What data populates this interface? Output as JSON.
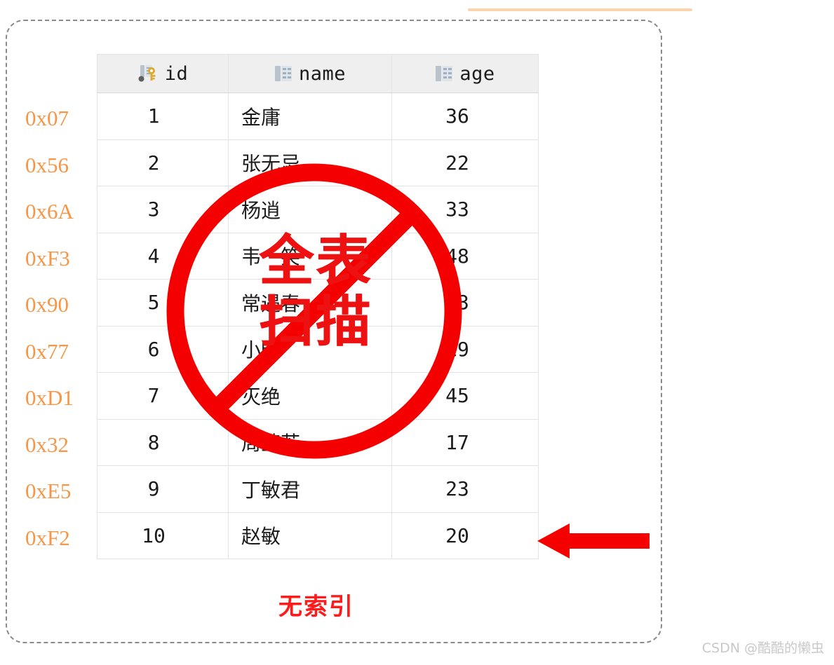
{
  "figure": {
    "caption": "无索引",
    "overlay_label_line1": "全表",
    "overlay_label_line2": "扫描",
    "watermark": "CSDN @酷酷的懒虫"
  },
  "colors": {
    "address_orange": "#f79646",
    "overlay_red": "#ee1111",
    "caption_red": "#fc1c1c",
    "arrow_red": "#f40000",
    "dashed_border": "#8a8a8a",
    "header_bg": "#efefef",
    "grid_line": "#e3e3e3",
    "top_rule": "#fbd3ae",
    "key_icon": "#e0a92b",
    "column_icon": "#9fb0c4",
    "watermark_gray": "#c9c9c9"
  },
  "table": {
    "columns": [
      {
        "label": "id",
        "icon": "primary-key-icon"
      },
      {
        "label": "name",
        "icon": "table-column-icon"
      },
      {
        "label": "age",
        "icon": "table-column-icon"
      }
    ],
    "addresses": [
      "0x07",
      "0x56",
      "0x6A",
      "0xF3",
      "0x90",
      "0x77",
      "0xD1",
      "0x32",
      "0xE5",
      "0xF2"
    ],
    "rows": [
      {
        "id": "1",
        "name": "金庸",
        "age": "36"
      },
      {
        "id": "2",
        "name": "张无忌",
        "age": "22"
      },
      {
        "id": "3",
        "name": "杨逍",
        "age": "33"
      },
      {
        "id": "4",
        "name": "韦一笑",
        "age": "48"
      },
      {
        "id": "5",
        "name": "常遇春",
        "age": "53"
      },
      {
        "id": "6",
        "name": "小昭",
        "age": "19"
      },
      {
        "id": "7",
        "name": "灭绝",
        "age": "45"
      },
      {
        "id": "8",
        "name": "周芷若",
        "age": "17"
      },
      {
        "id": "9",
        "name": "丁敏君",
        "age": "23"
      },
      {
        "id": "10",
        "name": "赵敏",
        "age": "20"
      }
    ]
  }
}
